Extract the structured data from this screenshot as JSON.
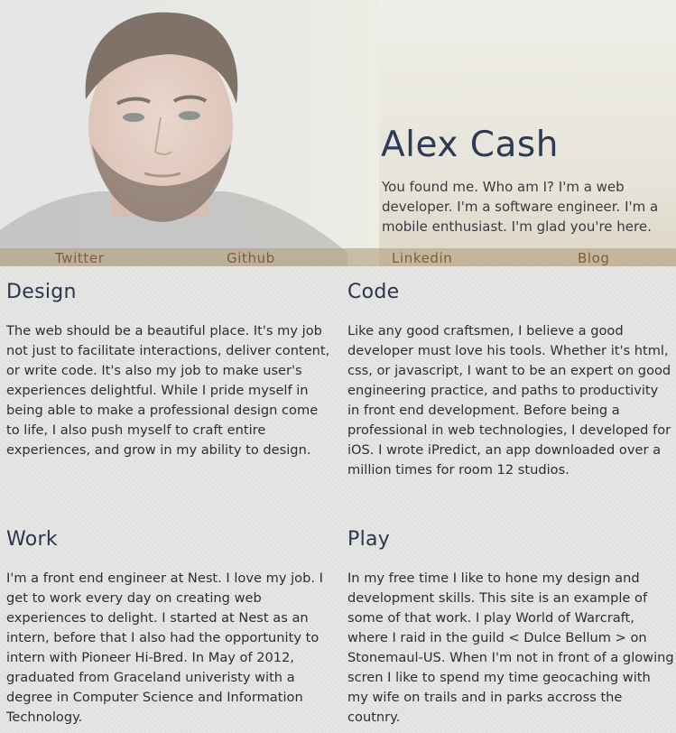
{
  "header": {
    "name": "Alex Cash",
    "tagline": "You found me. Who am I? I'm a web developer. I'm a software engineer. I'm a mobile enthusiast. I'm glad you're here."
  },
  "nav": {
    "items": [
      {
        "label": "Twitter"
      },
      {
        "label": "Github"
      },
      {
        "label": "Linkedin"
      },
      {
        "label": "Blog"
      }
    ]
  },
  "sections": [
    {
      "title": "Design",
      "body": "The web should be a beautiful place. It's my job not just to facilitate interactions, deliver content, or write code. It's also my job to make user's experiences delightful. While I pride myself in being able to make a professional design come to life, I also push myself to craft entire experiences, and grow in my ability to design."
    },
    {
      "title": "Code",
      "body": "Like any good craftsmen, I believe a good developer must love his tools. Whether it's html, css, or javascript, I want to be an expert on good engineering practice, and paths to productivity in front end development. Before being a professional in web technologies, I developed for iOS. I wrote iPredict, an app downloaded over a million times for room 12 studios."
    },
    {
      "title": "Work",
      "body": "I'm a front end engineer at Nest. I love my job. I get to work every day on creating web experiences to delight. I started at Nest as an intern, before that I also had the opportunity to intern with Pioneer Hi-Bred. In May of 2012, graduated from Graceland univeristy with a degree in Computer Science and Information Technology."
    },
    {
      "title": "Play",
      "body": "In my free time I like to hone my design and development skills. This site is an example of some of that work. I play World of Warcraft, where I raid in the guild < Dulce Bellum > on Stonemaul-US. When I'm not in front of a glowing scren I like to spend my time geocaching with my wife on trails and in parks accross the coutnry."
    }
  ],
  "colors": {
    "name": "#2d3a56",
    "nav_bar": "#b4a582",
    "nav_link": "#7e5d3c",
    "background": "#e4e4e2"
  }
}
